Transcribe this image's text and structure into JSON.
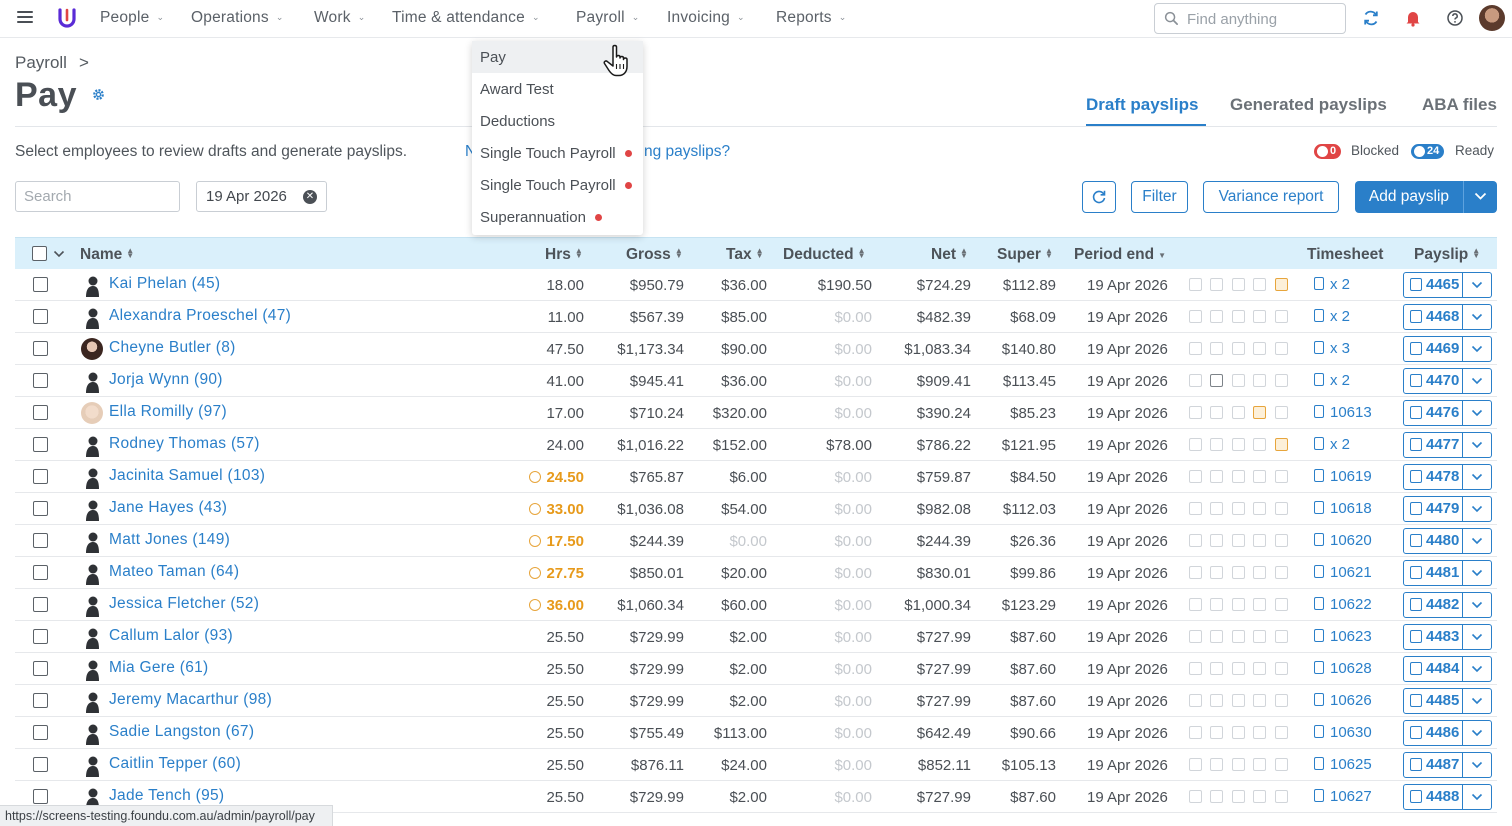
{
  "nav": {
    "items": [
      {
        "label": "People"
      },
      {
        "label": "Operations"
      },
      {
        "label": "Work"
      },
      {
        "label": "Time & attendance"
      },
      {
        "label": "Payroll"
      },
      {
        "label": "Invoicing"
      },
      {
        "label": "Reports"
      }
    ],
    "search_placeholder": "Find anything"
  },
  "payroll_menu": {
    "items": [
      {
        "label": "Pay",
        "badge": false
      },
      {
        "label": "Award Test",
        "badge": false
      },
      {
        "label": "Deductions",
        "badge": false
      },
      {
        "label": "Single Touch Payroll",
        "badge": true
      },
      {
        "label": "Single Touch Payroll",
        "badge": true
      },
      {
        "label": "Superannuation",
        "badge": true
      }
    ]
  },
  "header": {
    "breadcrumb": "Payroll",
    "breadcrumb_sep": ">",
    "title": "Pay",
    "tabs": [
      {
        "label": "Draft payslips",
        "active": true
      },
      {
        "label": "Generated payslips",
        "active": false
      },
      {
        "label": "ABA files",
        "active": false
      }
    ],
    "intro": "Select employees to review drafts and generate payslips.",
    "intro_link_start": "N",
    "intro_link_end": "ng payslips?",
    "blocked_count": "0",
    "blocked_label": "Blocked",
    "ready_count": "24",
    "ready_label": "Ready"
  },
  "toolbar": {
    "search_placeholder": "Search",
    "date": "19 Apr 2026",
    "filter_label": "Filter",
    "variance_label": "Variance report",
    "add_label": "Add payslip"
  },
  "table": {
    "columns": [
      "Name",
      "Hrs",
      "Gross",
      "Tax",
      "Deducted",
      "Net",
      "Super",
      "Period end",
      "Timesheet",
      "Payslip"
    ],
    "rows": [
      {
        "name": "Kai Phelan (45)",
        "hrs": "18.00",
        "gross": "$950.79",
        "tax": "$36.00",
        "deducted": "$190.50",
        "net": "$724.29",
        "super": "$112.89",
        "period": "19 Apr 2026",
        "timesheet": "x 2",
        "payslip": "4465"
      },
      {
        "name": "Alexandra Proeschel (47)",
        "hrs": "11.00",
        "gross": "$567.39",
        "tax": "$85.00",
        "deducted": "$0.00",
        "net": "$482.39",
        "super": "$68.09",
        "period": "19 Apr 2026",
        "timesheet": "x 2",
        "payslip": "4468"
      },
      {
        "name": "Cheyne Butler (8)",
        "hrs": "47.50",
        "gross": "$1,173.34",
        "tax": "$90.00",
        "deducted": "$0.00",
        "net": "$1,083.34",
        "super": "$140.80",
        "period": "19 Apr 2026",
        "timesheet": "x 3",
        "payslip": "4469"
      },
      {
        "name": "Jorja Wynn (90)",
        "hrs": "41.00",
        "gross": "$945.41",
        "tax": "$36.00",
        "deducted": "$0.00",
        "net": "$909.41",
        "super": "$113.45",
        "period": "19 Apr 2026",
        "timesheet": "x 2",
        "payslip": "4470"
      },
      {
        "name": "Ella Romilly (97)",
        "hrs": "17.00",
        "gross": "$710.24",
        "tax": "$320.00",
        "deducted": "$0.00",
        "net": "$390.24",
        "super": "$85.23",
        "period": "19 Apr 2026",
        "timesheet": "10613",
        "payslip": "4476"
      },
      {
        "name": "Rodney Thomas (57)",
        "hrs": "24.00",
        "gross": "$1,016.22",
        "tax": "$152.00",
        "deducted": "$78.00",
        "net": "$786.22",
        "super": "$121.95",
        "period": "19 Apr 2026",
        "timesheet": "x 2",
        "payslip": "4477"
      },
      {
        "name": "Jacinita Samuel (103)",
        "hrs": "24.50",
        "gross": "$765.87",
        "tax": "$6.00",
        "deducted": "$0.00",
        "net": "$759.87",
        "super": "$84.50",
        "period": "19 Apr 2026",
        "timesheet": "10619",
        "payslip": "4478"
      },
      {
        "name": "Jane Hayes (43)",
        "hrs": "33.00",
        "gross": "$1,036.08",
        "tax": "$54.00",
        "deducted": "$0.00",
        "net": "$982.08",
        "super": "$112.03",
        "period": "19 Apr 2026",
        "timesheet": "10618",
        "payslip": "4479"
      },
      {
        "name": "Matt Jones (149)",
        "hrs": "17.50",
        "gross": "$244.39",
        "tax": "$0.00",
        "deducted": "$0.00",
        "net": "$244.39",
        "super": "$26.36",
        "period": "19 Apr 2026",
        "timesheet": "10620",
        "payslip": "4480"
      },
      {
        "name": "Mateo Taman (64)",
        "hrs": "27.75",
        "gross": "$850.01",
        "tax": "$20.00",
        "deducted": "$0.00",
        "net": "$830.01",
        "super": "$99.86",
        "period": "19 Apr 2026",
        "timesheet": "10621",
        "payslip": "4481"
      },
      {
        "name": "Jessica Fletcher (52)",
        "hrs": "36.00",
        "gross": "$1,060.34",
        "tax": "$60.00",
        "deducted": "$0.00",
        "net": "$1,000.34",
        "super": "$123.29",
        "period": "19 Apr 2026",
        "timesheet": "10622",
        "payslip": "4482"
      },
      {
        "name": "Callum Lalor (93)",
        "hrs": "25.50",
        "gross": "$729.99",
        "tax": "$2.00",
        "deducted": "$0.00",
        "net": "$727.99",
        "super": "$87.60",
        "period": "19 Apr 2026",
        "timesheet": "10623",
        "payslip": "4483"
      },
      {
        "name": "Mia Gere (61)",
        "hrs": "25.50",
        "gross": "$729.99",
        "tax": "$2.00",
        "deducted": "$0.00",
        "net": "$727.99",
        "super": "$87.60",
        "period": "19 Apr 2026",
        "timesheet": "10628",
        "payslip": "4484"
      },
      {
        "name": "Jeremy Macarthur (98)",
        "hrs": "25.50",
        "gross": "$729.99",
        "tax": "$2.00",
        "deducted": "$0.00",
        "net": "$727.99",
        "super": "$87.60",
        "period": "19 Apr 2026",
        "timesheet": "10626",
        "payslip": "4485"
      },
      {
        "name": "Sadie Langston (67)",
        "hrs": "25.50",
        "gross": "$755.49",
        "tax": "$113.00",
        "deducted": "$0.00",
        "net": "$642.49",
        "super": "$90.66",
        "period": "19 Apr 2026",
        "timesheet": "10630",
        "payslip": "4486"
      },
      {
        "name": "Caitlin Tepper (60)",
        "hrs": "25.50",
        "gross": "$876.11",
        "tax": "$24.00",
        "deducted": "$0.00",
        "net": "$852.11",
        "super": "$105.13",
        "period": "19 Apr 2026",
        "timesheet": "10625",
        "payslip": "4487"
      },
      {
        "name": "Jade Tench (95)",
        "hrs": "25.50",
        "gross": "$729.99",
        "tax": "$2.00",
        "deducted": "$0.00",
        "net": "$727.99",
        "super": "$87.60",
        "period": "19 Apr 2026",
        "timesheet": "10627",
        "payslip": "4488"
      }
    ]
  },
  "status_url": "https://screens-testing.foundu.com.au/admin/payroll/pay",
  "colors": {
    "accent": "#2a7fc9",
    "warning": "#e79a1b",
    "danger": "#e04545",
    "header_bg": "#daf0fb"
  }
}
